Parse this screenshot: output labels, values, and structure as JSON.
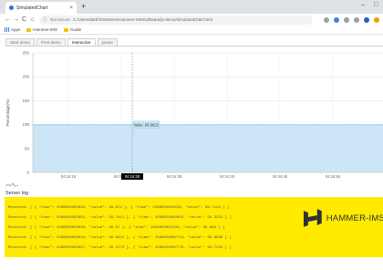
{
  "browser": {
    "tab_title": "SimulatedChart",
    "tab_close": "×",
    "new_tab": "+",
    "window_controls": {
      "minimize": "–",
      "maximize": "□"
    },
    "nav": {
      "back": "←",
      "forward": "→",
      "reload": "C",
      "home": "⌂"
    },
    "address": {
      "security": "Not secure",
      "url": "C:/Users/darth/OneDrive/Hammer-IMS/software/js-demo/simulatedchart.html"
    },
    "bookmarks": [
      "Apps",
      "Hammer-IMS",
      "Guide"
    ]
  },
  "page": {
    "tabs": [
      "Start demo",
      "Print demo",
      "Interactive",
      "pause"
    ],
    "active_tab_index": 2,
    "server_log_title": "Server log",
    "log_lines": [
      "Received: [ { \"time\": 1568650002848, \"value\": 99.674 }, { \"time\": 1568650002933, \"value\": 99.7143 } ]",
      "Received: [ { \"time\": 1568650002852, \"value\": 99.7811 }, { \"time\": 1568650002855, \"value\": 99.3331 } ]",
      "Received: [ { \"time\": 1568650002828, \"value\": 99.67 }, { \"time\": 1568650002136, \"value\": 99.694 } ]",
      "Received: [ { \"time\": 1568650002842, \"value\": 99.6641 }, { \"time\": 1568650002716, \"value\": 99.6996 } ]",
      "Received: [ { \"time\": 1568650002857, \"value\": 99.1273 }, { \"time\": 1568650002778, \"value\": 99.7233 } ]"
    ],
    "logo_text": "HAMMER-IMS",
    "colors": {
      "log_panel": "#ffea00",
      "area_fill": "#cde6f7",
      "area_line": "#8ec8ec",
      "tooltip_bg": "#c9e6f7"
    }
  },
  "chart_data": {
    "type": "area",
    "ylabel": "Percentage(%)",
    "ylim": [
      0,
      250
    ],
    "yticks": [
      0,
      50,
      100,
      150,
      200,
      250
    ],
    "xticks": [
      "04:24:15",
      "04:24:30",
      "04:24:35",
      "04:24:40",
      "04:24:45",
      "04:24:50"
    ],
    "series": [
      {
        "values": [
          99.6,
          99.6,
          99.7,
          99.6,
          99.7,
          99.6,
          99.7,
          99.6,
          99.7,
          99.6,
          99.7,
          99.6
        ]
      }
    ],
    "tooltip": "Value: 99.9622",
    "crosshair_label": "04:24:30",
    "grid": true
  }
}
